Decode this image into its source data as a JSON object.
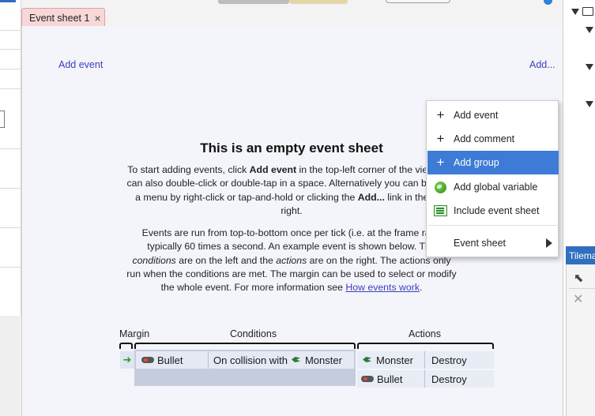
{
  "tab": {
    "title": "Event sheet 1",
    "close_glyph": "×"
  },
  "toolbar": {
    "add_event_link": "Add event",
    "add_link": "Add..."
  },
  "empty_sheet": {
    "title": "This is an empty event sheet",
    "para1": {
      "t1": "To start adding events, click ",
      "b1": "Add event",
      "t2": " in the top-left corner of the view. You can also double-click or double-tap in a space. Alternatively you can bring up a menu by right-click or tap-and-hold or clicking the ",
      "b2": "Add...",
      "t3": " link in the top-right."
    },
    "para2": {
      "t1": "Events are run from top-to-bottom once per tick (i.e. at the frame rate, typically 60 times a second. An example event is shown below. The ",
      "i1": "conditions",
      "t2": " are on the left and the ",
      "i2": "actions",
      "t3": " are on the right. The actions only run when the conditions are met. The margin can be used to select or modify the whole event. For more information see ",
      "link": "How events work",
      "t4": "."
    }
  },
  "example": {
    "headers": {
      "margin": "Margin",
      "conditions": "Conditions",
      "actions": "Actions"
    },
    "condition": {
      "object": "Bullet",
      "text": "On collision with",
      "target": "Monster"
    },
    "actions": [
      {
        "object": "Monster",
        "action": "Destroy"
      },
      {
        "object": "Bullet",
        "action": "Destroy"
      }
    ]
  },
  "context_menu": {
    "items": [
      {
        "label": "Add event",
        "icon": "plus-icon"
      },
      {
        "label": "Add comment",
        "icon": "plus-icon"
      },
      {
        "label": "Add group",
        "icon": "plus-icon",
        "highlighted": true
      },
      {
        "label": "Add global variable",
        "icon": "globe-icon"
      },
      {
        "label": "Include event sheet",
        "icon": "event-sheet-icon"
      },
      {
        "label": "Event sheet",
        "icon": "submenu-arrow-icon"
      }
    ]
  },
  "right_panel": {
    "tilemap_title": "Tilemap"
  },
  "colors": {
    "accent": "#3d7bd6",
    "tab_bg": "#f7d7d7",
    "link": "#3a3fb7",
    "panel_header": "#2f6fbf"
  }
}
